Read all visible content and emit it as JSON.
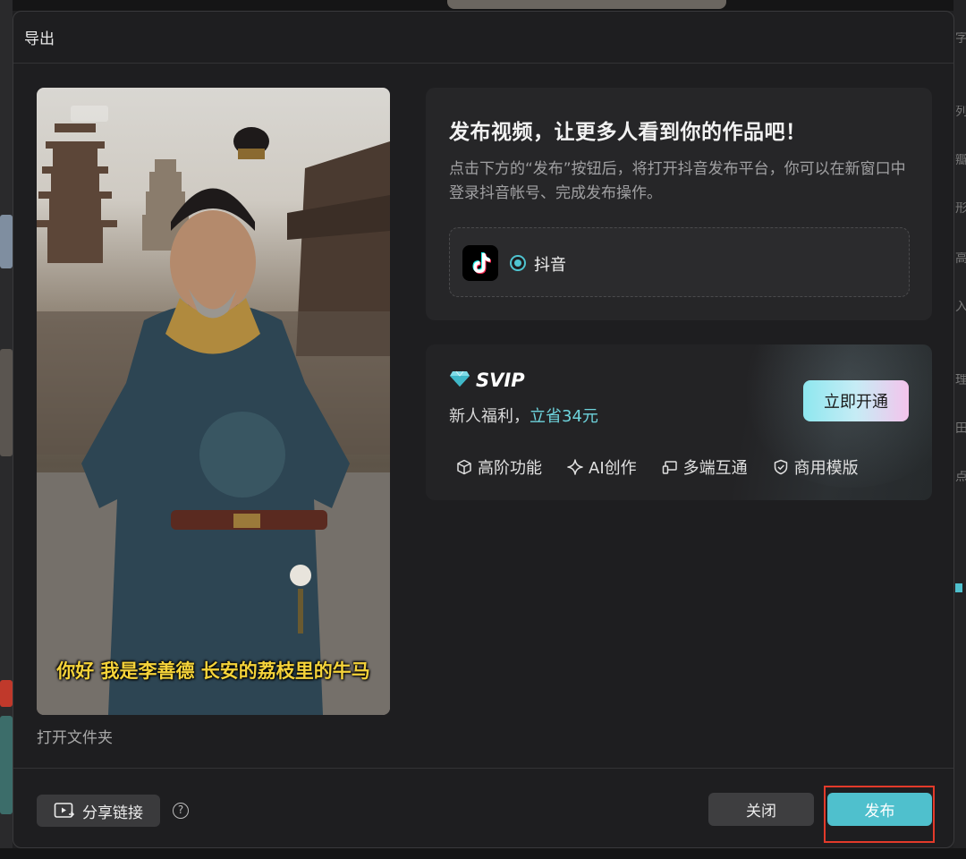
{
  "dialog": {
    "title": "导出"
  },
  "preview": {
    "subtitle": "你好 我是李善德 长安的荔枝里的牛马",
    "open_folder_label": "打开文件夹"
  },
  "publish": {
    "heading": "发布视频，让更多人看到你的作品吧！",
    "description": "点击下方的“发布”按钮后，将打开抖音发布平台，你可以在新窗口中登录抖音帐号、完成发布操作。",
    "platform": {
      "name": "抖音",
      "selected": true,
      "icon": "douyin-logo"
    }
  },
  "svip": {
    "title": "SVIP",
    "offer_prefix": "新人福利，",
    "offer_accent": "立省34元",
    "open_button": "立即开通",
    "features": [
      {
        "icon": "cube-icon",
        "label": "高阶功能"
      },
      {
        "icon": "sparkle-icon",
        "label": "AI创作"
      },
      {
        "icon": "devices-icon",
        "label": "多端互通"
      },
      {
        "icon": "shield-check-icon",
        "label": "商用模版"
      }
    ],
    "accent_color": "#6ed3dc"
  },
  "footer": {
    "share_label": "分享链接",
    "close_label": "关闭",
    "publish_label": "发布",
    "publish_color": "#4fc0cd"
  }
}
